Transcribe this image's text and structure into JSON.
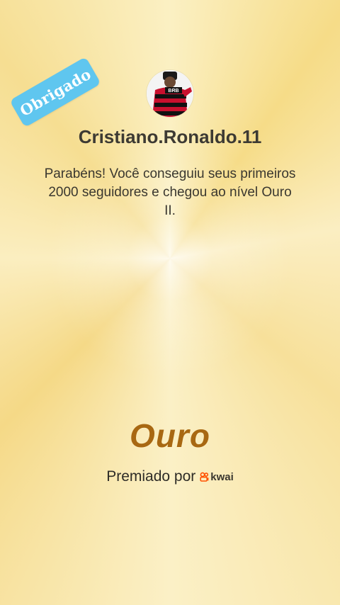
{
  "badge": {
    "label": "Obrigado",
    "color": "#5fc6ef"
  },
  "profile": {
    "username": "Cristiano.Ronaldo.11",
    "avatar_jersey_text": "BRB",
    "avatar_colors": {
      "jersey_red": "#c8102e",
      "jersey_black": "#111111"
    }
  },
  "message": {
    "text": "Parabéns! Você conseguiu seus primeiros 2000 seguidores e chegou ao nível Ouro II."
  },
  "level": {
    "title": "Ouro",
    "color": "#a86812"
  },
  "footer": {
    "awarded_by_label": "Premiado por",
    "brand_name": "kwai",
    "brand_icon": "kwai-logo-icon",
    "brand_color": "#ff5000"
  }
}
